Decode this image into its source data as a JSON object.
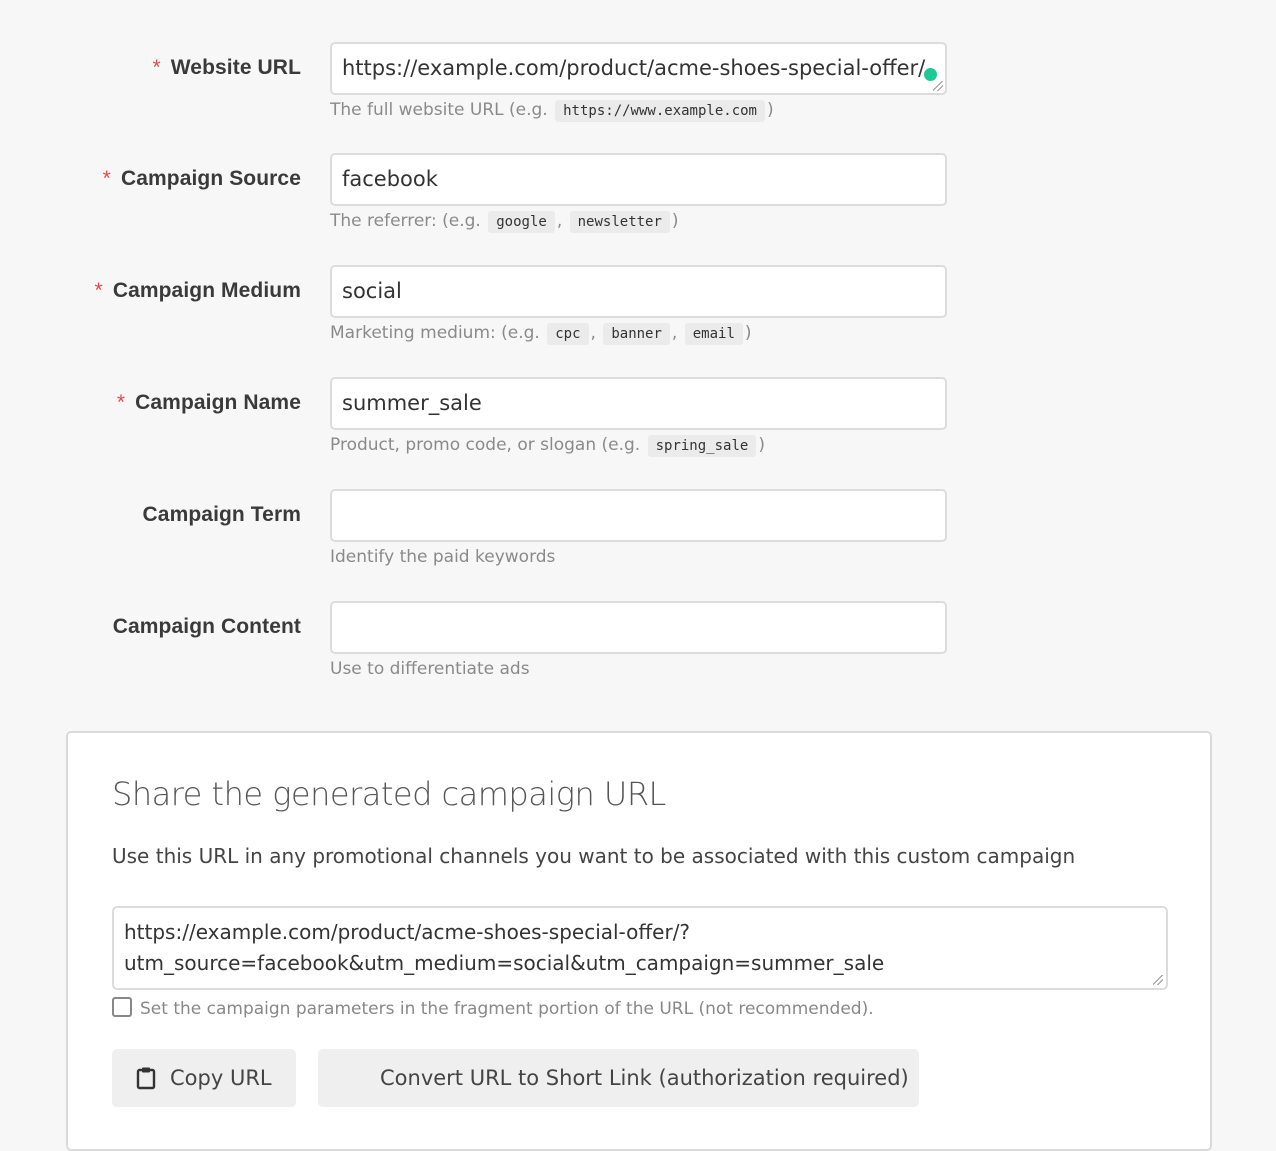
{
  "form": {
    "fields": [
      {
        "label": "Website URL",
        "required": true,
        "value": "https://example.com/product/acme-shoes-special-offer/",
        "hint_prefix": "The full website URL (e.g.",
        "hint_codes": [
          "https://www.example.com"
        ],
        "hint_suffix": ")"
      },
      {
        "label": "Campaign Source",
        "required": true,
        "value": "facebook",
        "hint_prefix": "The referrer: (e.g.",
        "hint_codes": [
          "google",
          "newsletter"
        ],
        "hint_suffix": ")"
      },
      {
        "label": "Campaign Medium",
        "required": true,
        "value": "social",
        "hint_prefix": "Marketing medium: (e.g.",
        "hint_codes": [
          "cpc",
          "banner",
          "email"
        ],
        "hint_suffix": ")"
      },
      {
        "label": "Campaign Name",
        "required": true,
        "value": "summer_sale",
        "hint_prefix": "Product, promo code, or slogan (e.g.",
        "hint_codes": [
          "spring_sale"
        ],
        "hint_suffix": ")"
      },
      {
        "label": "Campaign Term",
        "required": false,
        "value": "",
        "hint_prefix": "Identify the paid keywords",
        "hint_codes": [],
        "hint_suffix": ""
      },
      {
        "label": "Campaign Content",
        "required": false,
        "value": "",
        "hint_prefix": "Use to differentiate ads",
        "hint_codes": [],
        "hint_suffix": ""
      }
    ],
    "required_marker": "*",
    "status_dot_color": "#1ec997"
  },
  "share": {
    "title": "Share the generated campaign URL",
    "description": "Use this URL in any promotional channels you want to be associated with this custom campaign",
    "generated_url_line1": "https://example.com/product/acme-shoes-special-offer/?",
    "generated_url_line2": "utm_source=facebook&utm_medium=social&utm_campaign=summer_sale",
    "fragment_checkbox_label": "Set the campaign parameters in the fragment portion of the URL (not recommended).",
    "fragment_checked": false,
    "copy_button": {
      "label": "Copy URL",
      "icon": "clipboard-icon"
    },
    "short_link_button": {
      "label": "Convert URL to Short Link (authorization required)"
    }
  }
}
